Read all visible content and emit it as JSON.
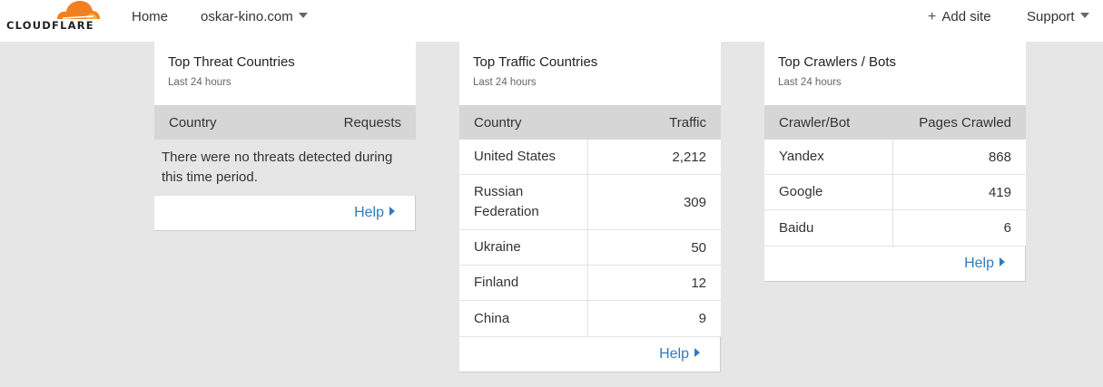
{
  "brand": {
    "name": "CLOUDFLARE",
    "accent": "#f38020",
    "cloud_light": "#fbad41"
  },
  "nav": {
    "home": "Home",
    "domain": "oskar-kino.com",
    "add_site": "Add site",
    "add_site_icon": "plus-icon",
    "support": "Support"
  },
  "threat_card": {
    "title": "Top Threat Countries",
    "subtitle": "Last 24 hours",
    "col1": "Country",
    "col2": "Requests",
    "empty_message": "There were no threats detected during this time period.",
    "help": "Help"
  },
  "traffic_card": {
    "title": "Top Traffic Countries",
    "subtitle": "Last 24 hours",
    "col1": "Country",
    "col2": "Traffic",
    "rows": [
      {
        "name": "United States",
        "value": "2,212"
      },
      {
        "name": "Russian Federation",
        "value": "309"
      },
      {
        "name": "Ukraine",
        "value": "50"
      },
      {
        "name": "Finland",
        "value": "12"
      },
      {
        "name": "China",
        "value": "9"
      }
    ],
    "help": "Help"
  },
  "crawler_card": {
    "title": "Top Crawlers / Bots",
    "subtitle": "Last 24 hours",
    "col1": "Crawler/Bot",
    "col2": "Pages Crawled",
    "rows": [
      {
        "name": "Yandex",
        "value": "868"
      },
      {
        "name": "Google",
        "value": "419"
      },
      {
        "name": "Baidu",
        "value": "6"
      }
    ],
    "help": "Help"
  }
}
